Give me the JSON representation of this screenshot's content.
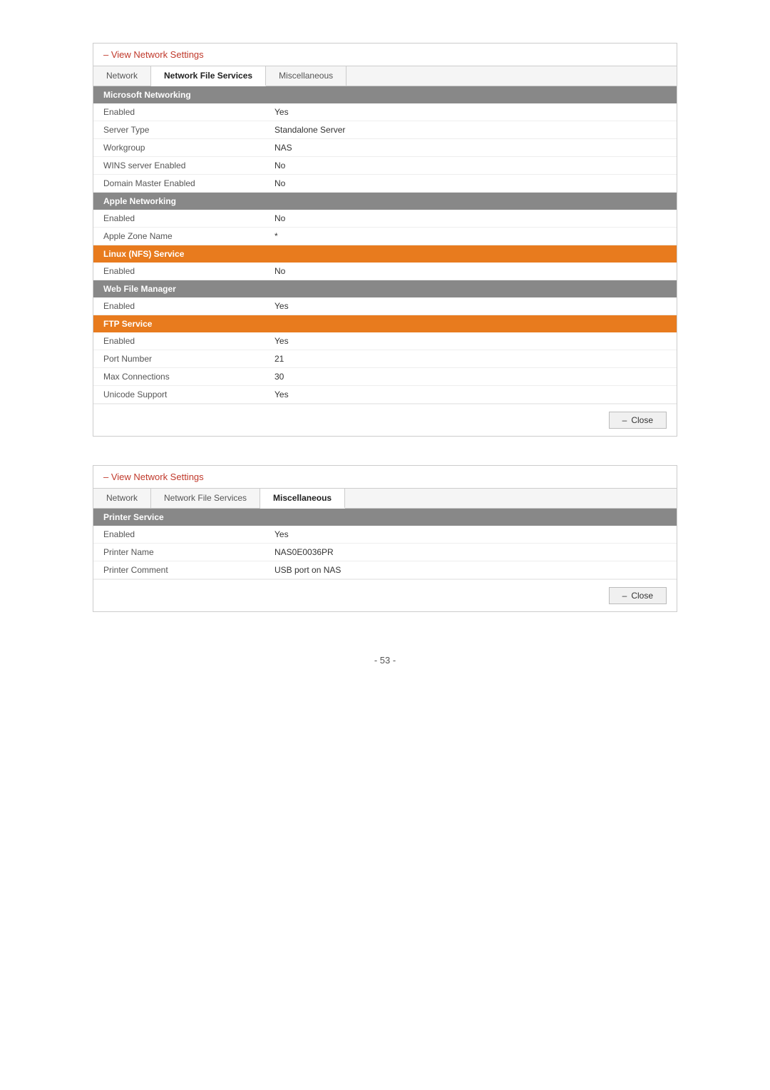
{
  "panel1": {
    "title": "– View Network Settings",
    "tabs": [
      {
        "label": "Network",
        "active": false
      },
      {
        "label": "Network File Services",
        "active": true
      },
      {
        "label": "Miscellaneous",
        "active": false
      }
    ],
    "sections": [
      {
        "header": "Microsoft Networking",
        "color": "gray",
        "rows": [
          {
            "label": "Enabled",
            "value": "Yes"
          },
          {
            "label": "Server Type",
            "value": "Standalone Server"
          },
          {
            "label": "Workgroup",
            "value": "NAS"
          },
          {
            "label": "WINS server Enabled",
            "value": "No"
          },
          {
            "label": "Domain Master Enabled",
            "value": "No"
          }
        ]
      },
      {
        "header": "Apple Networking",
        "color": "gray",
        "rows": [
          {
            "label": "Enabled",
            "value": "No"
          },
          {
            "label": "Apple Zone Name",
            "value": "*"
          }
        ]
      },
      {
        "header": "Linux (NFS) Service",
        "color": "orange",
        "rows": [
          {
            "label": "Enabled",
            "value": "No"
          }
        ]
      },
      {
        "header": "Web File Manager",
        "color": "gray",
        "rows": [
          {
            "label": "Enabled",
            "value": "Yes"
          }
        ]
      },
      {
        "header": "FTP Service",
        "color": "orange",
        "rows": [
          {
            "label": "Enabled",
            "value": "Yes"
          },
          {
            "label": "Port Number",
            "value": "21"
          },
          {
            "label": "Max Connections",
            "value": "30"
          },
          {
            "label": "Unicode Support",
            "value": "Yes"
          }
        ]
      }
    ],
    "close_label": "Close"
  },
  "panel2": {
    "title": "– View Network Settings",
    "tabs": [
      {
        "label": "Network",
        "active": false
      },
      {
        "label": "Network File Services",
        "active": false
      },
      {
        "label": "Miscellaneous",
        "active": true
      }
    ],
    "sections": [
      {
        "header": "Printer Service",
        "color": "gray",
        "rows": [
          {
            "label": "Enabled",
            "value": "Yes"
          },
          {
            "label": "Printer Name",
            "value": "NAS0E0036PR"
          },
          {
            "label": "Printer Comment",
            "value": "USB port on NAS"
          }
        ]
      }
    ],
    "close_label": "Close"
  },
  "page_number": "- 53 -"
}
